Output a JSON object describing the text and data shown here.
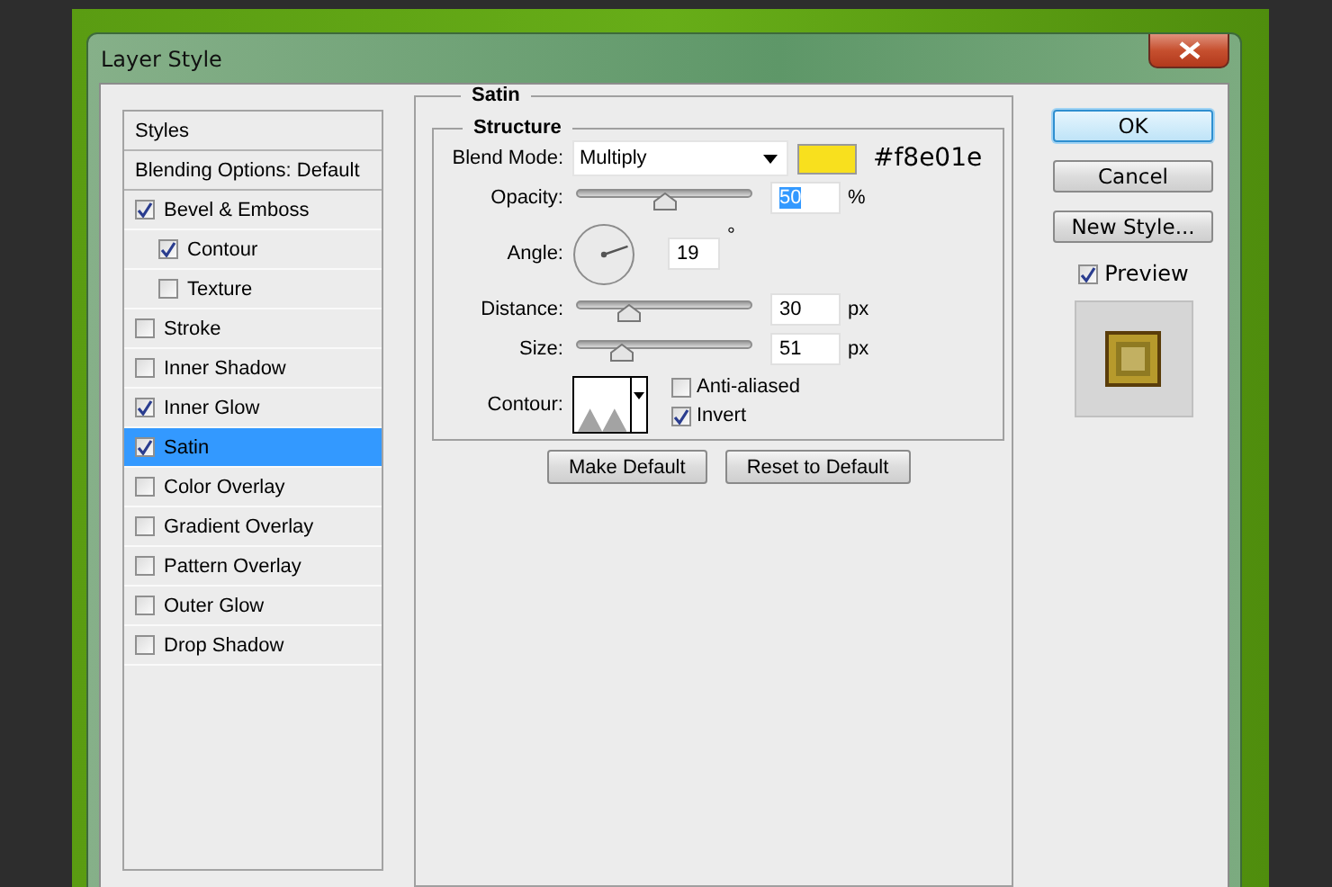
{
  "window": {
    "title": "Layer Style"
  },
  "styles_panel": {
    "items": [
      {
        "kind": "header",
        "label": "Styles",
        "selected": false
      },
      {
        "kind": "option",
        "label": "Blending Options: Default",
        "selected": false
      },
      {
        "kind": "effect",
        "label": "Bevel & Emboss",
        "checked": true,
        "selected": false,
        "children": [
          {
            "kind": "effect",
            "label": "Contour",
            "checked": true,
            "selected": false
          },
          {
            "kind": "effect",
            "label": "Texture",
            "checked": false,
            "selected": false
          }
        ]
      },
      {
        "kind": "effect",
        "label": "Stroke",
        "checked": false,
        "selected": false
      },
      {
        "kind": "effect",
        "label": "Inner Shadow",
        "checked": false,
        "selected": false
      },
      {
        "kind": "effect",
        "label": "Inner Glow",
        "checked": true,
        "selected": false
      },
      {
        "kind": "effect",
        "label": "Satin",
        "checked": true,
        "selected": true
      },
      {
        "kind": "effect",
        "label": "Color Overlay",
        "checked": false,
        "selected": false
      },
      {
        "kind": "effect",
        "label": "Gradient Overlay",
        "checked": false,
        "selected": false
      },
      {
        "kind": "effect",
        "label": "Pattern Overlay",
        "checked": false,
        "selected": false
      },
      {
        "kind": "effect",
        "label": "Outer Glow",
        "checked": false,
        "selected": false
      },
      {
        "kind": "effect",
        "label": "Drop Shadow",
        "checked": false,
        "selected": false
      }
    ]
  },
  "satin": {
    "title": "Satin",
    "structure": {
      "title": "Structure",
      "blend_mode": {
        "label": "Blend Mode:",
        "value": "Multiply",
        "color_code": "#f8e01e"
      },
      "opacity": {
        "label": "Opacity:",
        "value": "50",
        "unit": "%",
        "level": 0.5,
        "text_selected": true
      },
      "angle": {
        "label": "Angle:",
        "value": "19",
        "unit": "°"
      },
      "distance": {
        "label": "Distance:",
        "value": "30",
        "unit": "px",
        "level": 0.3
      },
      "size": {
        "label": "Size:",
        "value": "51",
        "unit": "px",
        "level": 0.26
      },
      "contour": {
        "label": "Contour:",
        "options": [
          {
            "label": "Anti-aliased",
            "checked": false
          },
          {
            "label": "Invert",
            "checked": true
          }
        ]
      }
    },
    "buttons": [
      "Make Default",
      "Reset to Default"
    ]
  },
  "actions": [
    {
      "label": "OK",
      "default": true
    },
    {
      "label": "Cancel",
      "default": false
    },
    {
      "label": "New Style...",
      "default": false
    }
  ],
  "preview": {
    "label": "Preview",
    "checked": true
  }
}
